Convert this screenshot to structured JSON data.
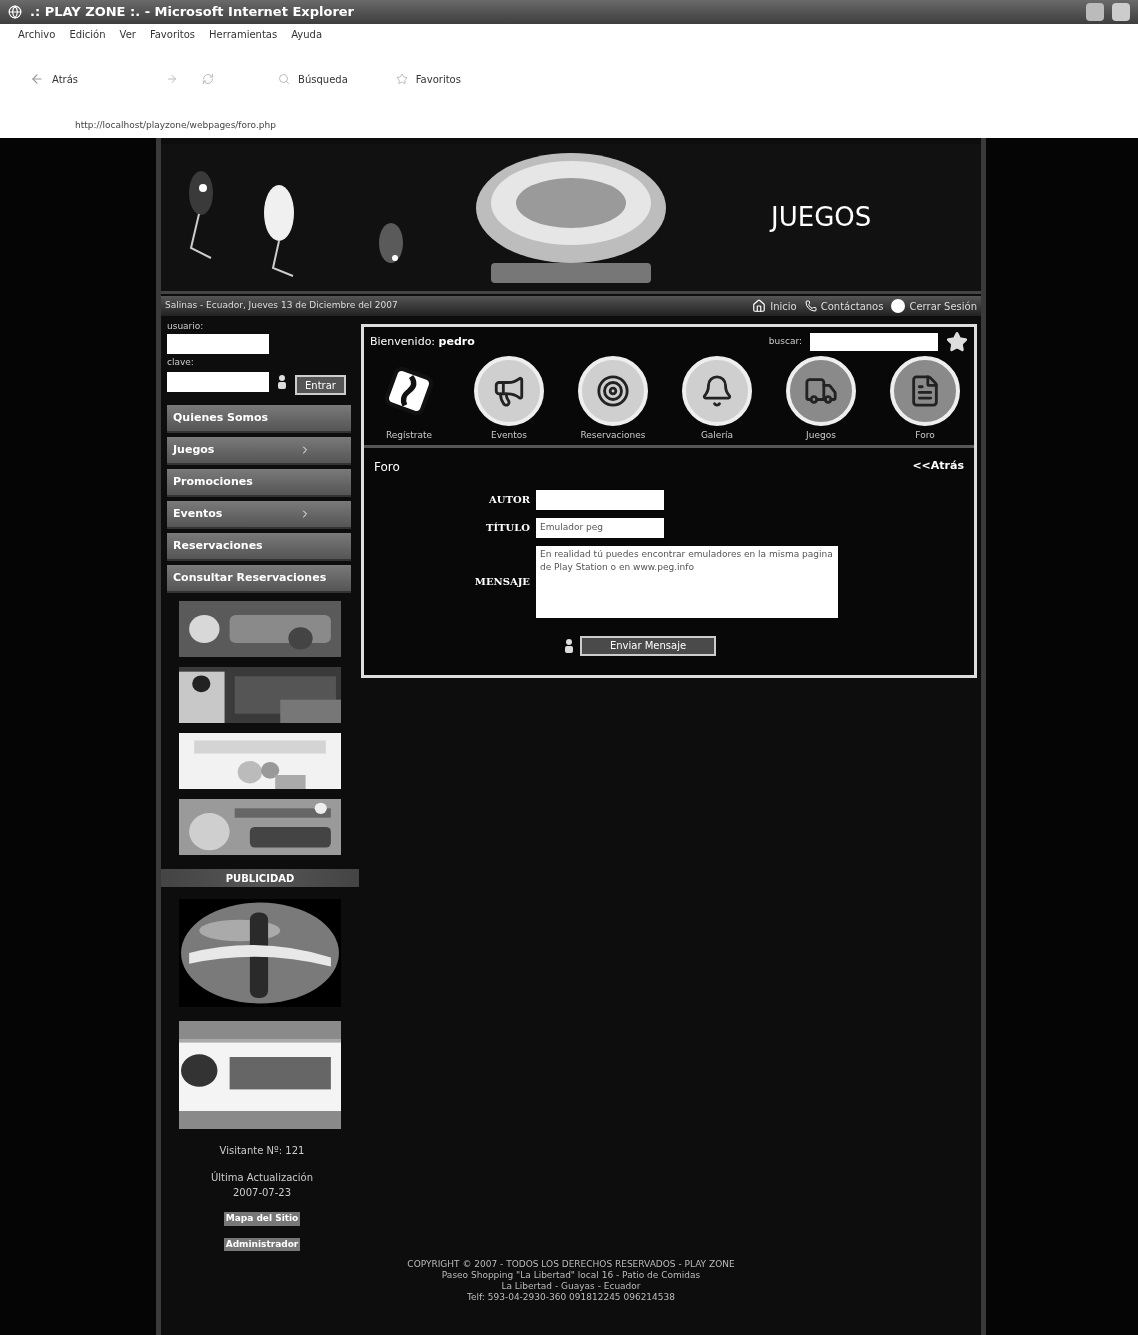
{
  "browser": {
    "title": ".: PLAY ZONE :. - Microsoft Internet Explorer",
    "menu": [
      "Archivo",
      "Edición",
      "Ver",
      "Favoritos",
      "Herramientas",
      "Ayuda"
    ],
    "toolbar": [
      "Atrás",
      "Búsqueda",
      "Favoritos"
    ],
    "address": "http://localhost/playzone/webpages/foro.php"
  },
  "header": {
    "section_title": "JUEGOS"
  },
  "nav": {
    "date": "Salinas - Ecuador, Jueves 13 de Diciembre del 2007",
    "links": [
      "Inicio",
      "Contáctanos",
      "Cerrar Sesión"
    ]
  },
  "login": {
    "user_label": "usuario:",
    "pass_label": "clave:",
    "button": "Entrar"
  },
  "menu": [
    {
      "label": "Quienes Somos",
      "has_submenu": false
    },
    {
      "label": "Juegos",
      "has_submenu": true
    },
    {
      "label": "Promociones",
      "has_submenu": false
    },
    {
      "label": "Eventos",
      "has_submenu": true
    },
    {
      "label": "Reservaciones",
      "has_submenu": false
    },
    {
      "label": "Consultar Reservaciones",
      "has_submenu": false
    }
  ],
  "advertising": {
    "heading": "PUBLICIDAD"
  },
  "stats": {
    "visitors": "Visitante Nº: 121",
    "update_label": "Última Actualización",
    "update_date": "2007-07-23",
    "links": [
      "Mapa del Sitio",
      "Administrador"
    ]
  },
  "main": {
    "welcome": "Bienvenido: **pedro**",
    "search_label": "buscar:",
    "shortcuts": [
      {
        "label": "Regístrate"
      },
      {
        "label": "Eventos"
      },
      {
        "label": "Reservaciones"
      },
      {
        "label": "Galería"
      },
      {
        "label": "Juegos"
      },
      {
        "label": "Foro"
      }
    ],
    "title": "Foro",
    "back": "<<Atrás",
    "fields": [
      {
        "label": "AUTOR",
        "kind": "input"
      },
      {
        "label": "TÍTULO",
        "kind": "input",
        "value": "Emulador peg"
      },
      {
        "label": "MENSAJE",
        "kind": "textarea",
        "value": "En realidad tú puedes encontrar emuladores en la misma pagina de Play Station o en www.peg.info"
      }
    ],
    "submit": "Enviar Mensaje"
  },
  "footer": [
    "COPYRIGHT © 2007 - TODOS LOS DERECHOS RESERVADOS - PLAY ZONE",
    "Paseo Shopping \"La Libertad\" local 16 - Patio de Comidas",
    "La Libertad - Guayas - Ecuador",
    "Telf: 593-04-2930-360 091812245 096214538"
  ]
}
